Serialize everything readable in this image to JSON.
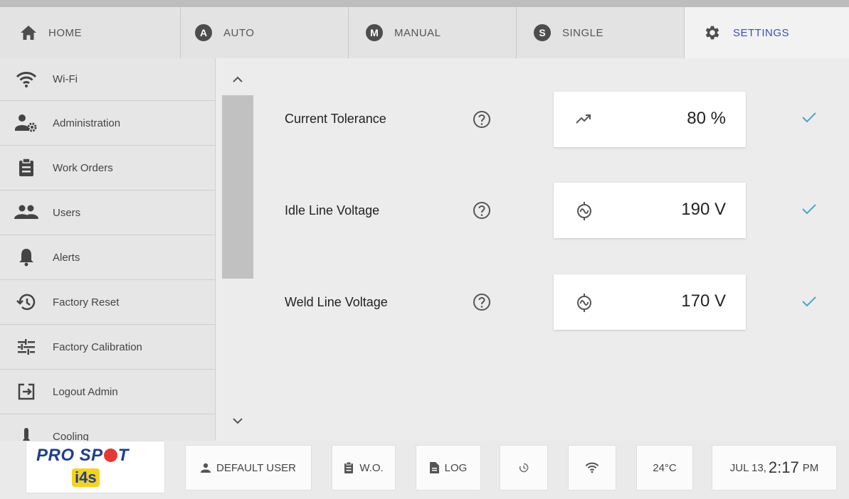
{
  "tabs": [
    {
      "label": "HOME",
      "icon": "home-icon"
    },
    {
      "label": "AUTO",
      "badge": "A"
    },
    {
      "label": "MANUAL",
      "badge": "M"
    },
    {
      "label": "SINGLE",
      "badge": "S"
    },
    {
      "label": "SETTINGS",
      "icon": "gear-icon",
      "active": true
    }
  ],
  "sidebar": {
    "items": [
      {
        "label": "Wi-Fi",
        "icon": "wifi-icon"
      },
      {
        "label": "Administration",
        "icon": "admin-icon"
      },
      {
        "label": "Work Orders",
        "icon": "clipboard-icon"
      },
      {
        "label": "Users",
        "icon": "users-icon"
      },
      {
        "label": "Alerts",
        "icon": "bell-icon"
      },
      {
        "label": "Factory Reset",
        "icon": "history-icon"
      },
      {
        "label": "Factory Calibration",
        "icon": "sliders-icon"
      },
      {
        "label": "Logout Admin",
        "icon": "logout-icon"
      },
      {
        "label": "Cooling",
        "icon": "thermometer-icon"
      }
    ]
  },
  "settings": [
    {
      "label": "Current Tolerance",
      "value": "80 %",
      "icon": "trending-up-icon"
    },
    {
      "label": "Idle Line Voltage",
      "value": "190 V",
      "icon": "ac-voltage-icon"
    },
    {
      "label": "Weld Line Voltage",
      "value": "170 V",
      "icon": "ac-voltage-icon"
    }
  ],
  "bottom": {
    "brand_a": "PRO SP",
    "brand_b": "T",
    "brand_sub": "i4s",
    "user": "DEFAULT USER",
    "wo": "W.O.",
    "log": "LOG",
    "temp": "24°C",
    "date": "JUL 13,",
    "time": "2:17",
    "ampm": "PM"
  },
  "colors": {
    "accent": "#3a4fb7",
    "check": "#4aa3c8",
    "brand_blue": "#1e3f8f",
    "brand_red": "#e53935",
    "brand_yellow": "#f7d21c"
  }
}
